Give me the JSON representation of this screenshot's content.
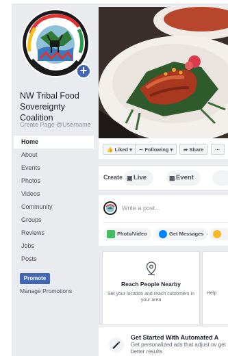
{
  "page": {
    "name": "NW Tribal Food Sovereignty Coalition",
    "create_url_label": "Create Page @Username"
  },
  "nav": {
    "items": [
      {
        "label": "Home",
        "active": true
      },
      {
        "label": "About"
      },
      {
        "label": "Events"
      },
      {
        "label": "Photos"
      },
      {
        "label": "Videos"
      },
      {
        "label": "Community"
      },
      {
        "label": "Groups"
      },
      {
        "label": "Reviews"
      },
      {
        "label": "Jobs"
      },
      {
        "label": "Posts"
      }
    ],
    "promote_label": "Promote",
    "manage_promotions_label": "Manage Promotions"
  },
  "action_bar": {
    "liked_label": "Liked",
    "following_label": "Following",
    "share_label": "Share",
    "more_label": "···"
  },
  "create_bar": {
    "label": "Create",
    "live_label": "Live",
    "event_label": "Event"
  },
  "composer": {
    "placeholder": "Write a post...",
    "photo_video_label": "Photo/Video",
    "get_messages_label": "Get Messages"
  },
  "promo_cards": [
    {
      "title": "Reach People Nearby",
      "description": "Set your location and reach customers in your area"
    },
    {
      "title": "",
      "description": "Help"
    }
  ],
  "automated_ads": {
    "title": "Get Started With Automated A",
    "description": "Get personalized ads that adjust ov get better results"
  },
  "colors": {
    "brand_blue": "#4267b2",
    "page_background": "#e9ebee",
    "text_primary": "#1d2129",
    "text_secondary": "#606770"
  }
}
